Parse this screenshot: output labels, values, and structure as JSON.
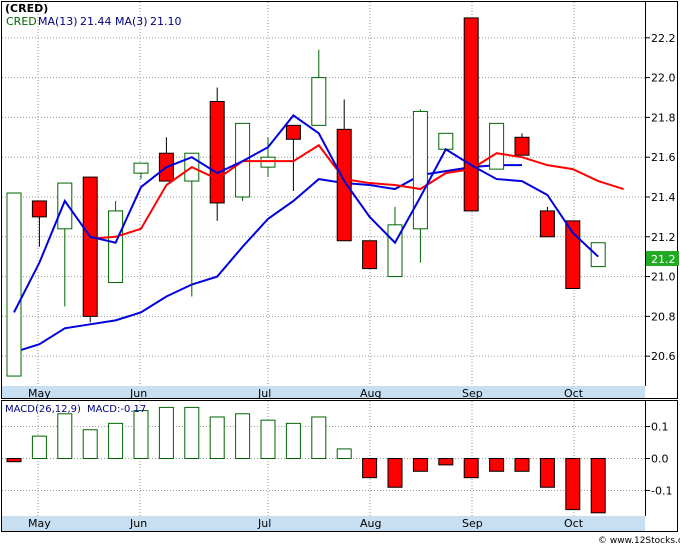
{
  "header": {
    "ticker": "(CRED)",
    "symbol": "CRED",
    "ma13_label": "MA(13)",
    "ma13_value": "21.44",
    "ma3_label": "MA(3)",
    "ma3_value": "21.10",
    "macd_label": "MACD(26,12,9)",
    "macd_value_label": "MACD:-0.17"
  },
  "last_price_tag": "21.2",
  "watermark": "© www.12Stocks.com",
  "colors": {
    "up": "#006400",
    "down": "#ff0000",
    "ma13": "#ff0000",
    "ma3": "#0000dd",
    "axis_bg": "#c8dff2",
    "grid": "#999999",
    "price_tag_bg": "#22aa22"
  },
  "chart_data": [
    {
      "type": "candlestick",
      "title": "(CRED)",
      "x_tick_labels": [
        "May",
        "Jun",
        "Jul",
        "Aug",
        "Sep",
        "Oct"
      ],
      "y_tick_labels": [
        "20.6",
        "20.8",
        "21.0",
        "21.2",
        "21.4",
        "21.6",
        "21.8",
        "22.0",
        "22.2"
      ],
      "ylim": [
        20.45,
        22.38
      ],
      "grid": true,
      "series": [
        {
          "name": "Price",
          "candles": [
            {
              "open": 20.5,
              "close": 21.42,
              "high": 21.42,
              "low": 20.5
            },
            {
              "open": 21.38,
              "close": 21.3,
              "high": 21.38,
              "low": 21.15
            },
            {
              "open": 21.24,
              "close": 21.47,
              "high": 21.47,
              "low": 20.85
            },
            {
              "open": 21.5,
              "close": 20.8,
              "high": 21.5,
              "low": 20.77
            },
            {
              "open": 20.97,
              "close": 21.33,
              "high": 21.38,
              "low": 20.97
            },
            {
              "open": 21.52,
              "close": 21.57,
              "high": 21.57,
              "low": 21.49
            },
            {
              "open": 21.62,
              "close": 21.48,
              "high": 21.7,
              "low": 21.48
            },
            {
              "open": 21.48,
              "close": 21.62,
              "high": 21.62,
              "low": 20.9
            },
            {
              "open": 21.88,
              "close": 21.37,
              "high": 21.95,
              "low": 21.28
            },
            {
              "open": 21.4,
              "close": 21.77,
              "high": 21.77,
              "low": 21.38
            },
            {
              "open": 21.55,
              "close": 21.6,
              "high": 21.7,
              "low": 21.5
            },
            {
              "open": 21.76,
              "close": 21.69,
              "high": 21.76,
              "low": 21.43
            },
            {
              "open": 21.76,
              "close": 22.0,
              "high": 22.14,
              "low": 21.76
            },
            {
              "open": 21.74,
              "close": 21.18,
              "high": 21.89,
              "low": 21.18
            },
            {
              "open": 21.18,
              "close": 21.04,
              "high": 21.18,
              "low": 21.04
            },
            {
              "open": 21.0,
              "close": 21.26,
              "high": 21.35,
              "low": 21.0
            },
            {
              "open": 21.24,
              "close": 21.83,
              "high": 21.84,
              "low": 21.07
            },
            {
              "open": 21.64,
              "close": 21.72,
              "high": 21.72,
              "low": 21.64
            },
            {
              "open": 22.3,
              "close": 21.33,
              "high": 22.3,
              "low": 21.33
            },
            {
              "open": 21.54,
              "close": 21.77,
              "high": 21.77,
              "low": 21.54
            },
            {
              "open": 21.7,
              "close": 21.61,
              "high": 21.72,
              "low": 21.61
            },
            {
              "open": 21.33,
              "close": 21.2,
              "high": 21.35,
              "low": 21.2
            },
            {
              "open": 21.28,
              "close": 20.94,
              "high": 21.28,
              "low": 20.94
            },
            {
              "open": 21.05,
              "close": 21.17,
              "high": 21.17,
              "low": 21.05
            }
          ]
        },
        {
          "name": "MA(13)",
          "values": [
            null,
            null,
            null,
            21.19,
            21.2,
            21.24,
            21.46,
            21.55,
            21.49,
            21.58,
            21.58,
            21.58,
            21.66,
            21.49,
            21.47,
            21.46,
            21.44,
            21.52,
            21.54,
            21.62,
            21.6,
            21.56,
            21.54,
            21.48,
            21.44
          ]
        },
        {
          "name": "MA(3)",
          "values": [
            20.82,
            21.07,
            21.38,
            21.2,
            21.17,
            21.45,
            21.55,
            21.6,
            21.52,
            21.58,
            21.65,
            21.81,
            21.72,
            21.48,
            21.3,
            21.17,
            21.4,
            21.64,
            21.56,
            21.49,
            21.48,
            21.41,
            21.22,
            21.1
          ]
        },
        {
          "name": "MA(50)",
          "values": [
            20.62,
            20.66,
            20.74,
            20.76,
            20.78,
            20.82,
            20.9,
            20.96,
            21.0,
            21.15,
            21.29,
            21.38,
            21.49,
            21.47,
            21.46,
            21.44,
            21.51,
            21.53,
            21.55,
            21.56,
            21.56
          ]
        }
      ]
    },
    {
      "type": "bar",
      "title": "MACD(26,12,9)",
      "x_tick_labels": [
        "May",
        "Jun",
        "Jul",
        "Aug",
        "Sep",
        "Oct"
      ],
      "y_tick_labels": [
        "0.1",
        "0.0",
        "-0.1"
      ],
      "ylim": [
        -0.18,
        0.18
      ],
      "series": [
        {
          "name": "MACD",
          "values": [
            -0.01,
            0.07,
            0.14,
            0.09,
            0.11,
            0.15,
            0.16,
            0.16,
            0.13,
            0.14,
            0.12,
            0.11,
            0.13,
            0.03,
            -0.06,
            -0.09,
            -0.04,
            -0.02,
            -0.06,
            -0.04,
            -0.04,
            -0.09,
            -0.16,
            -0.17
          ]
        }
      ]
    }
  ]
}
